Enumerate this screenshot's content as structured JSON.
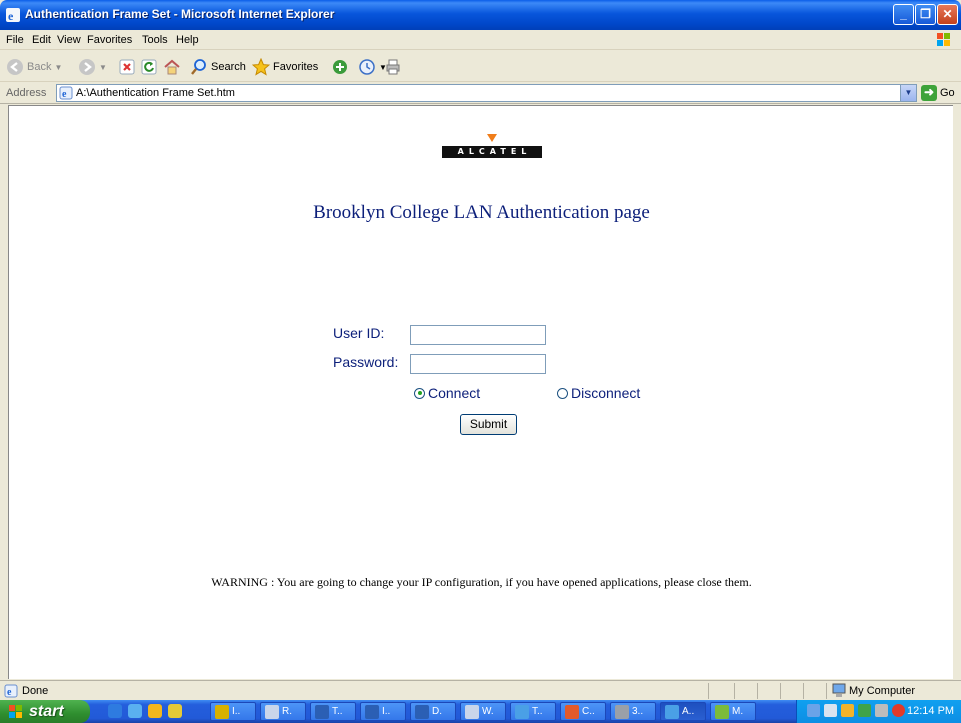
{
  "window": {
    "title": "Authentication Frame Set - Microsoft Internet Explorer"
  },
  "menubar": {
    "items": [
      "File",
      "Edit",
      "View",
      "Favorites",
      "Tools",
      "Help"
    ]
  },
  "toolbar": {
    "back_label": "Back",
    "search_label": "Search",
    "favorites_label": "Favorites"
  },
  "addressbar": {
    "label": "Address",
    "url": "A:\\Authentication Frame Set.htm",
    "go_label": "Go"
  },
  "page": {
    "logo_text": "ALCATEL",
    "heading": "Brooklyn College LAN Authentication page",
    "userid_label": "User ID:",
    "userid_value": "",
    "password_label": "Password:",
    "password_value": "",
    "connect_label": "Connect",
    "disconnect_label": "Disconnect",
    "selected_option": "Connect",
    "submit_label": "Submit",
    "warning": "WARNING : You are going to change your IP configuration, if you have opened applications, please close them."
  },
  "statusbar": {
    "status": "Done",
    "zone": "My Computer"
  },
  "taskbar": {
    "start_label": "start",
    "tasks": [
      {
        "label": "I..",
        "icon_color": "#d8b100",
        "active": false
      },
      {
        "label": "R.",
        "icon_color": "#c9d5ea",
        "active": false
      },
      {
        "label": "T..",
        "icon_color": "#2b5fb4",
        "active": false
      },
      {
        "label": "I..",
        "icon_color": "#2b5fb4",
        "active": false
      },
      {
        "label": "D.",
        "icon_color": "#2b5fb4",
        "active": false
      },
      {
        "label": "W.",
        "icon_color": "#c9d5ea",
        "active": false
      },
      {
        "label": "T..",
        "icon_color": "#4aa0e6",
        "active": false
      },
      {
        "label": "C..",
        "icon_color": "#e35a2a",
        "active": false
      },
      {
        "label": "3..",
        "icon_color": "#9aa0a8",
        "active": false
      },
      {
        "label": "A..",
        "icon_color": "#4aa0e6",
        "active": true
      },
      {
        "label": "M.",
        "icon_color": "#7cbb3a",
        "active": false
      }
    ],
    "clock": "12:14 PM"
  },
  "colors": {
    "heading": "#0c1f7a",
    "titlebar": "#0856dc",
    "logo_accent": "#f07d1a"
  }
}
